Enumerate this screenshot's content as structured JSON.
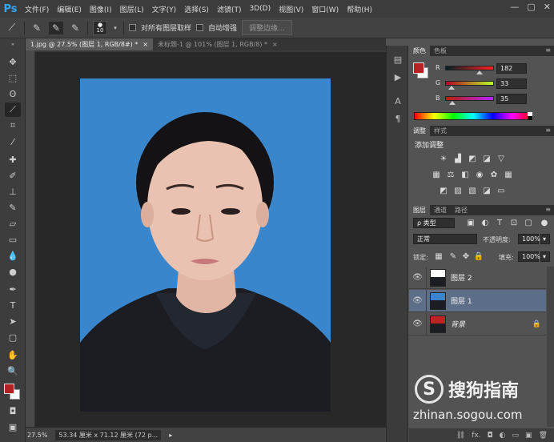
{
  "app": {
    "logo": "Ps"
  },
  "menu": [
    "文件(F)",
    "编辑(E)",
    "图像(I)",
    "图层(L)",
    "文字(Y)",
    "选择(S)",
    "滤镜(T)",
    "3D(D)",
    "视图(V)",
    "窗口(W)",
    "帮助(H)"
  ],
  "window_controls": {
    "minimize": "—",
    "restore": "▢",
    "close": "✕"
  },
  "options": {
    "brush_size": "10",
    "sample_all_layers": "对所有图层取样",
    "auto_enhance": "自动增强",
    "refine_edge": "调整边缘..."
  },
  "tabs": [
    {
      "label": "1.jpg @ 27.5% (图层 1, RGB/8#) *",
      "close": "×"
    },
    {
      "label": "未标题-1 @ 101% (图层 1, RGB/8) *",
      "close": "×"
    }
  ],
  "status": {
    "zoom": "27.5%",
    "doc_info": "53.34 厘米 x 71.12 厘米 (72 p..."
  },
  "color_panel": {
    "tabs": [
      "颜色",
      "色板"
    ],
    "r_label": "R",
    "g_label": "G",
    "b_label": "B",
    "r": "182",
    "g": "33",
    "b": "35",
    "r_level": 0.71,
    "g_level": 0.13,
    "b_level": 0.14,
    "swatch": "#b62123"
  },
  "adjustments_panel": {
    "tabs": [
      "调整",
      "样式"
    ],
    "title": "添加调整"
  },
  "layers_panel": {
    "tabs": [
      "图层",
      "通道",
      "路径"
    ],
    "filter": "ρ 类型",
    "blend_mode": "正常",
    "opacity_label": "不透明度:",
    "opacity": "100%",
    "lock_label": "锁定:",
    "fill_label": "填充:",
    "fill": "100%",
    "layers": [
      {
        "name": "图层 2",
        "selected": false,
        "locked": false
      },
      {
        "name": "图层 1",
        "selected": true,
        "locked": false
      },
      {
        "name": "背景",
        "selected": false,
        "locked": true
      }
    ]
  },
  "watermark": {
    "logo": "S",
    "name": "搜狗指南",
    "url": "zhinan.sogou.com"
  },
  "colors": {
    "accent": "#31a8ff",
    "foreground": "#b22222",
    "background": "#ffffff",
    "photo_bg": "#3a86cc"
  }
}
